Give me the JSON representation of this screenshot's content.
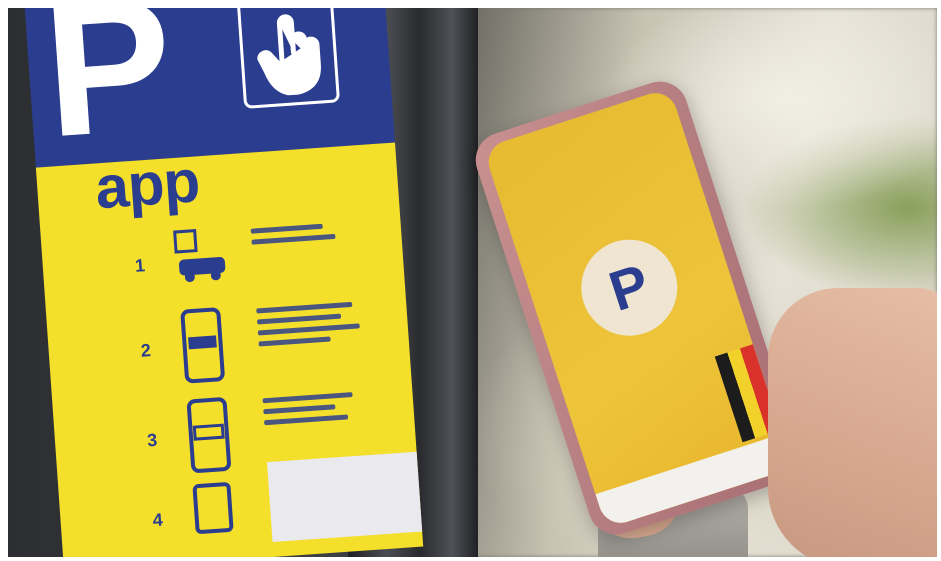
{
  "scene": {
    "description_visible_text": {
      "sticker_letter": "P",
      "sticker_word": "app",
      "steps": [
        "1",
        "2",
        "3",
        "4"
      ],
      "phone_logo_letter": "P"
    },
    "colors": {
      "sticker_blue": "#2b3d8f",
      "sticker_yellow": "#f4df2b",
      "phone_screen": "#e7bb31",
      "phone_case": "#b57e80"
    }
  }
}
